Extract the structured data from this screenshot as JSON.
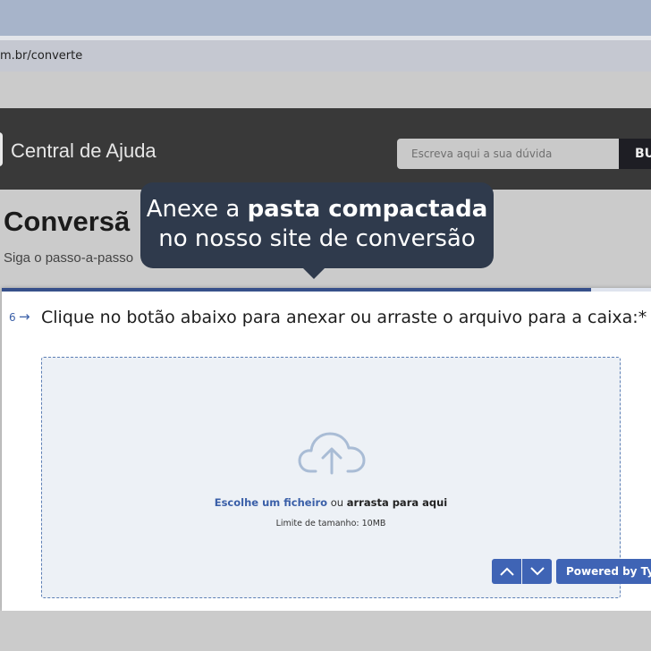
{
  "browser": {
    "url": "m.br/converte"
  },
  "header": {
    "brand": "Central de Ajuda",
    "search_placeholder": "Escreva aqui a sua dúvida",
    "search_button": "BU"
  },
  "page": {
    "title": "Conversã",
    "subtitle": "Siga o passo-a-passo"
  },
  "tooltip": {
    "text_before": "Anexe a ",
    "text_bold": "pasta compactada",
    "line2": "no nosso site de conversão"
  },
  "form": {
    "progress": 0.89,
    "question_number": "6",
    "question_arrow": "→",
    "question_text": "Clique no botão abaixo para anexar ou arraste o arquivo para a caixa:*",
    "dropzone": {
      "choose_label": "Escolhe um ficheiro",
      "or_label": "ou",
      "drag_label": "arrasta para aqui",
      "limit_label": "Limite de tamanho: 10MB",
      "icon": "cloud-upload-icon"
    },
    "powered_by": "Powered by Typeform"
  },
  "colors": {
    "accent": "#3f64b5",
    "tooltip_bg": "#2f3a4c",
    "header_bg": "#393939",
    "dropzone_bg": "#edf1f6"
  }
}
